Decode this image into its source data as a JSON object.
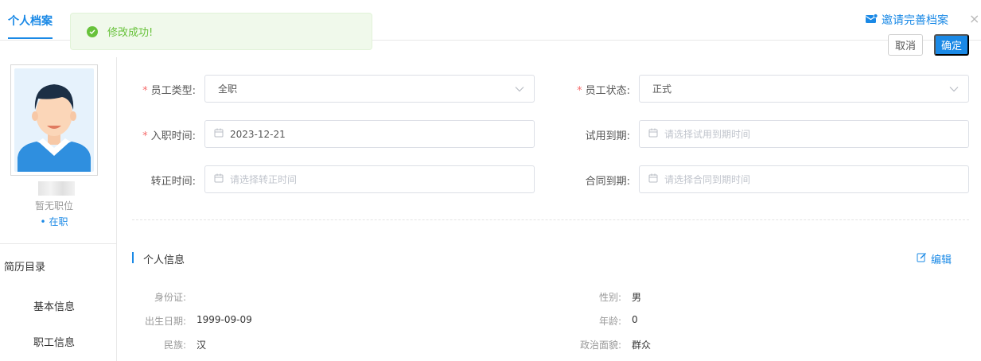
{
  "header": {
    "tab_label": "个人档案",
    "invite_label": "邀请完善档案",
    "close_symbol": "×"
  },
  "toast": {
    "message": "修改成功!",
    "color": "#67c23a"
  },
  "actions": {
    "cancel_label": "取消",
    "ok_label": "确定"
  },
  "profile": {
    "position": "暂无职位",
    "status": "• 在职"
  },
  "sidebar": {
    "section_title": "简历目录",
    "items": [
      {
        "label": "基本信息"
      },
      {
        "label": "职工信息"
      }
    ]
  },
  "employment": {
    "type_label": "员工类型:",
    "type_value": "全职",
    "status_label": "员工状态:",
    "status_value": "正式",
    "hire_label": "入职时间:",
    "hire_value": "2023-12-21",
    "probation_label": "试用到期:",
    "probation_placeholder": "请选择试用到期时间",
    "regular_label": "转正时间:",
    "regular_placeholder": "请选择转正时间",
    "contract_label": "合同到期:",
    "contract_placeholder": "请选择合同到期时间"
  },
  "personal": {
    "title": "个人信息",
    "edit_label": "编辑",
    "id_label": "身份证:",
    "id_value": "",
    "gender_label": "性别:",
    "gender_value": "男",
    "birth_label": "出生日期:",
    "birth_value": "1999-09-09",
    "age_label": "年龄:",
    "age_value": "0",
    "ethnic_label": "民族:",
    "ethnic_value": "汉",
    "political_label": "政治面貌:",
    "political_value": "群众"
  },
  "colors": {
    "accent": "#1a89e6",
    "required": "#f56c6c"
  }
}
